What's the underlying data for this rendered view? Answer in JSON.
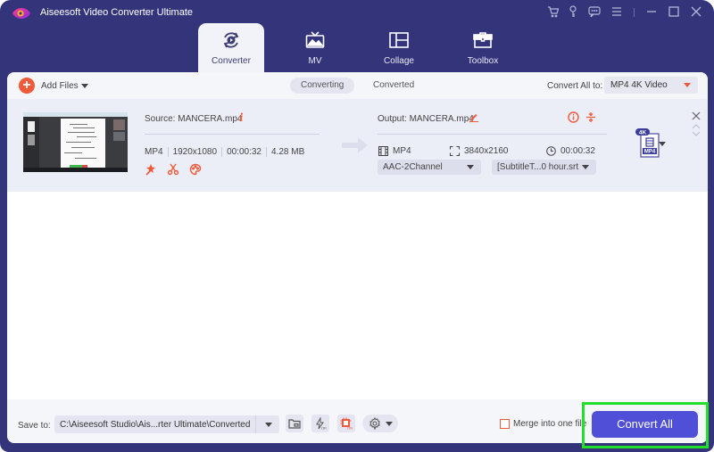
{
  "app": {
    "title": "Aiseesoft Video Converter Ultimate",
    "window_controls": [
      "cart-icon",
      "key-icon",
      "feedback-icon",
      "menu-icon",
      "minimize-icon",
      "maximize-icon",
      "close-icon"
    ]
  },
  "nav": {
    "tabs": [
      {
        "label": "Converter",
        "icon": "converter-icon",
        "active": true
      },
      {
        "label": "MV",
        "icon": "mv-icon",
        "active": false
      },
      {
        "label": "Collage",
        "icon": "collage-icon",
        "active": false
      },
      {
        "label": "Toolbox",
        "icon": "toolbox-icon",
        "active": false
      }
    ]
  },
  "toolbar": {
    "add_files_label": "Add Files",
    "segments": [
      {
        "label": "Converting",
        "active": true
      },
      {
        "label": "Converted",
        "active": false
      }
    ],
    "convert_all_to_label": "Convert All to:",
    "convert_all_to_value": "MP4 4K Video"
  },
  "file": {
    "source_name": "Source: MANCERA.mp4",
    "source_format": "MP4",
    "source_resolution": "1920x1080",
    "source_duration": "00:00:32",
    "source_size": "4.28 MB",
    "output_name": "Output: MANCERA.mp4",
    "output_format": "MP4",
    "output_resolution": "3840x2160",
    "output_duration": "00:00:32",
    "audio_track": "AAC-2Channel",
    "subtitle_track": "[SubtitleT...0 hour.srt",
    "format_badge": "4K",
    "format_badge_label": "MP4"
  },
  "footer": {
    "save_to_label": "Save to:",
    "save_path": "C:\\Aiseesoft Studio\\Ais...rter Ultimate\\Converted",
    "merge_label": "Merge into one file",
    "merge_checked": false,
    "convert_all_button": "Convert All"
  },
  "colors": {
    "frame": "#33347a",
    "accent_orange": "#ef5a3a",
    "primary_button": "#4f4fd8",
    "highlight": "#22e02a"
  }
}
